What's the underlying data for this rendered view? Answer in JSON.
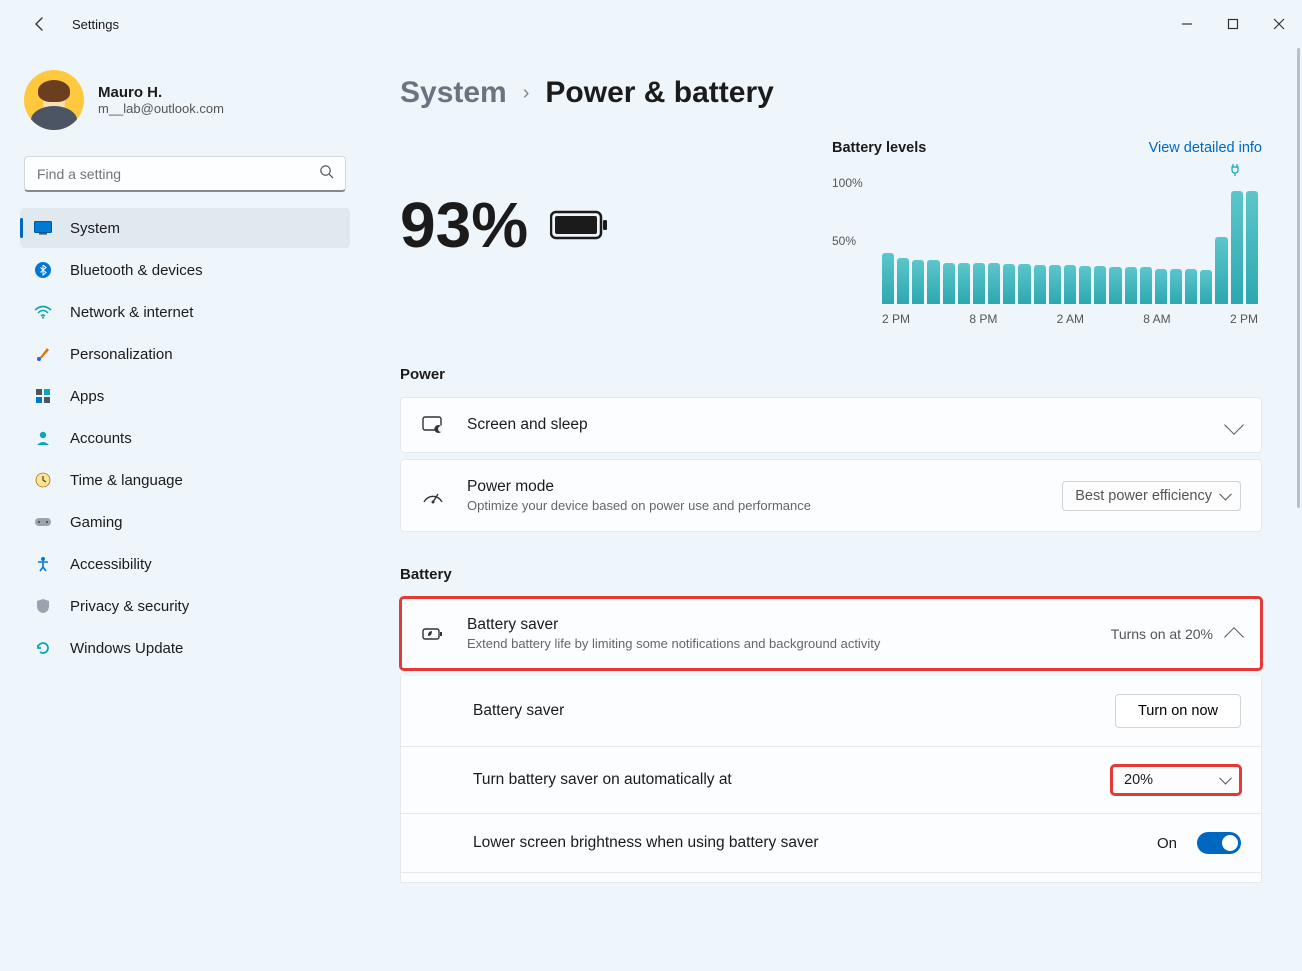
{
  "app": {
    "title": "Settings"
  },
  "profile": {
    "name": "Mauro H.",
    "email": "m__lab@outlook.com"
  },
  "search": {
    "placeholder": "Find a setting"
  },
  "nav": {
    "items": [
      {
        "label": "System"
      },
      {
        "label": "Bluetooth & devices"
      },
      {
        "label": "Network & internet"
      },
      {
        "label": "Personalization"
      },
      {
        "label": "Apps"
      },
      {
        "label": "Accounts"
      },
      {
        "label": "Time & language"
      },
      {
        "label": "Gaming"
      },
      {
        "label": "Accessibility"
      },
      {
        "label": "Privacy & security"
      },
      {
        "label": "Windows Update"
      }
    ]
  },
  "breadcrumb": {
    "parent": "System",
    "current": "Power & battery"
  },
  "battery": {
    "percent": "93%",
    "chart_title": "Battery levels",
    "view_link": "View detailed info"
  },
  "chart_data": {
    "type": "bar",
    "categories": [
      "2 PM",
      "3 PM",
      "4 PM",
      "5 PM",
      "6 PM",
      "7 PM",
      "8 PM",
      "9 PM",
      "10 PM",
      "11 PM",
      "12 AM",
      "1 AM",
      "2 AM",
      "3 AM",
      "4 AM",
      "5 AM",
      "6 AM",
      "7 AM",
      "8 AM",
      "9 AM",
      "10 AM",
      "11 AM",
      "12 PM",
      "1 PM",
      "2 PM"
    ],
    "values": [
      42,
      38,
      36,
      36,
      34,
      34,
      34,
      34,
      33,
      33,
      32,
      32,
      32,
      31,
      31,
      30,
      30,
      30,
      29,
      29,
      29,
      28,
      55,
      93,
      93
    ],
    "ylim": [
      0,
      100
    ],
    "yticks": {
      "t100": "100%",
      "t50": "50%"
    },
    "xticks": [
      "2 PM",
      "8 PM",
      "2 AM",
      "8 AM",
      "2 PM"
    ],
    "charging_marker_index": 23,
    "title": "Battery levels"
  },
  "sections": {
    "power": {
      "label": "Power",
      "screen_sleep": "Screen and sleep",
      "power_mode": {
        "title": "Power mode",
        "sub": "Optimize your device based on power use and performance",
        "value": "Best power efficiency"
      }
    },
    "battery": {
      "label": "Battery",
      "saver": {
        "title": "Battery saver",
        "sub": "Extend battery life by limiting some notifications and background activity",
        "summary": "Turns on at 20%"
      },
      "saver_row": {
        "label": "Battery saver",
        "button": "Turn on now"
      },
      "auto_row": {
        "label": "Turn battery saver on automatically at",
        "value": "20%"
      },
      "brightness_row": {
        "label": "Lower screen brightness when using battery saver",
        "state": "On"
      }
    }
  }
}
